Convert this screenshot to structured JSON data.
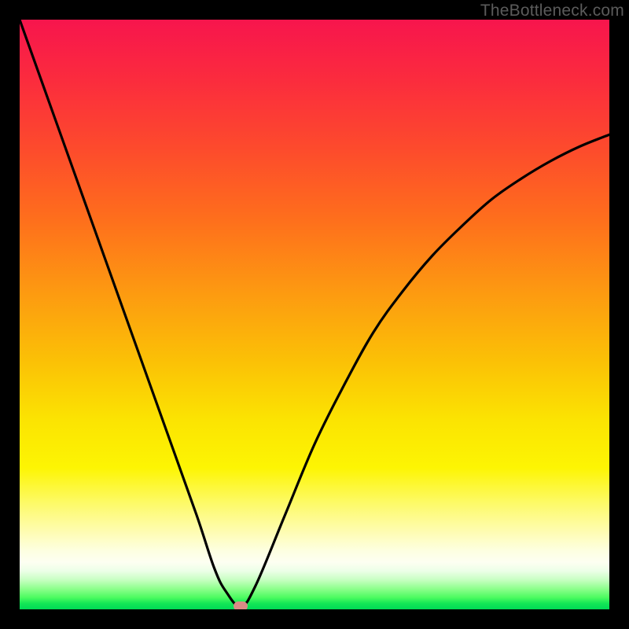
{
  "attribution": "TheBottleneck.com",
  "chart_data": {
    "type": "line",
    "title": "",
    "xlabel": "",
    "ylabel": "",
    "xlim": [
      0,
      100
    ],
    "ylim": [
      0,
      100
    ],
    "x": [
      0,
      5,
      10,
      15,
      20,
      25,
      30,
      33,
      35,
      37.5,
      40,
      45,
      50,
      55,
      60,
      65,
      70,
      75,
      80,
      85,
      90,
      95,
      100
    ],
    "values": [
      100,
      86,
      72,
      58,
      44,
      30,
      16,
      7,
      3,
      0.5,
      4,
      16,
      28,
      38,
      47,
      54,
      60,
      65,
      69.5,
      73,
      76,
      78.5,
      80.5
    ],
    "annotations": [
      {
        "label": "min-marker",
        "x": 37.5,
        "y": 0.5
      }
    ],
    "gradient_stops": [
      {
        "pos": 0.0,
        "color": "#f7154d"
      },
      {
        "pos": 0.46,
        "color": "#fd9911"
      },
      {
        "pos": 0.76,
        "color": "#fdf503"
      },
      {
        "pos": 0.92,
        "color": "#fdfff2"
      },
      {
        "pos": 1.0,
        "color": "#00d955"
      }
    ]
  }
}
